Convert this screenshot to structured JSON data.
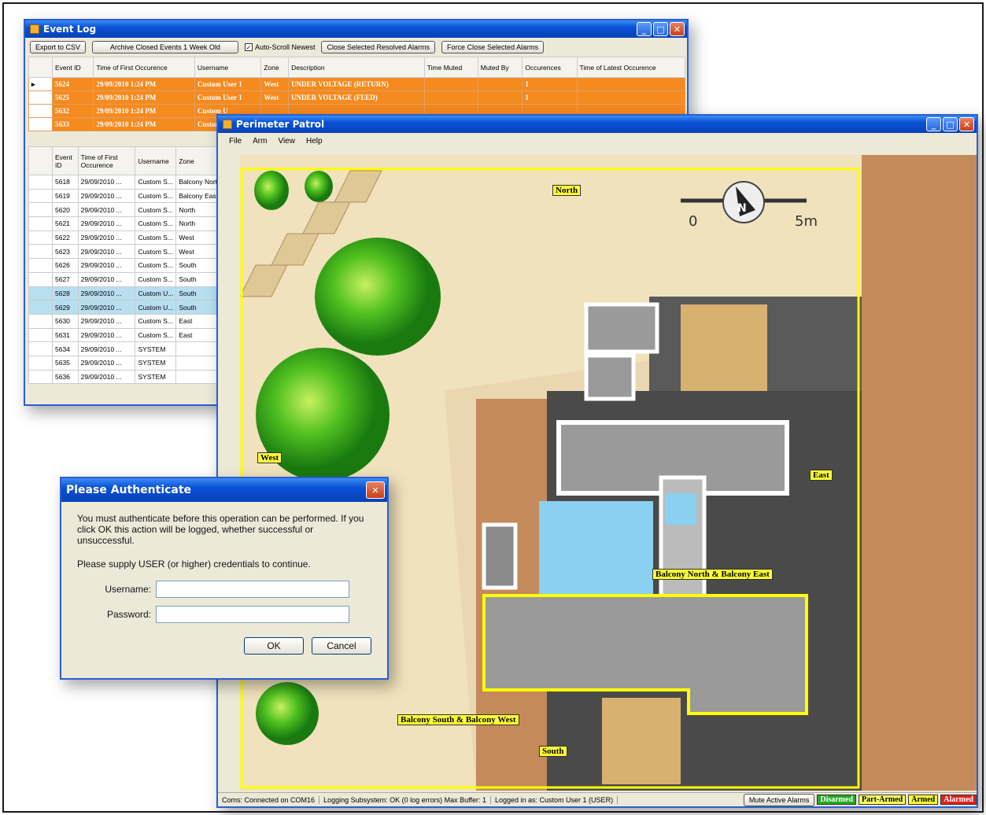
{
  "event_log": {
    "title": "Event Log",
    "toolbar": {
      "export": "Export to CSV",
      "archive": "Archive Closed Events 1 Week Old",
      "autoscroll": "Auto-Scroll Newest",
      "close_resolved": "Close Selected Resolved Alarms",
      "force_close": "Force Close Selected Alarms"
    },
    "active_columns": [
      "Event ID",
      "Time of First Occurence",
      "Username",
      "Zone",
      "Description",
      "Time Muted",
      "Muted By",
      "Occurences",
      "Time of Latest Occurence"
    ],
    "active_rows": [
      [
        "5624",
        "29/09/2010 1:24 PM",
        "Custom User 1",
        "West",
        "UNDER VOLTAGE (RETURN)",
        "",
        "",
        "1",
        ""
      ],
      [
        "5625",
        "29/09/2010 1:24 PM",
        "Custom User 1",
        "West",
        "UNDER VOLTAGE (FEED)",
        "",
        "",
        "1",
        ""
      ],
      [
        "5632",
        "29/09/2010 1:24 PM",
        "Custom U",
        "",
        "",
        "",
        "",
        "",
        ""
      ],
      [
        "5633",
        "29/09/2010 1:24 PM",
        "Custom",
        "",
        "",
        "",
        "",
        "",
        ""
      ]
    ],
    "history_columns": [
      "Event ID",
      "Time of First Occurence",
      "Username",
      "Zone"
    ],
    "history_rows": [
      [
        "5618",
        "29/09/2010 ...",
        "Custom S...",
        "Balcony Nort"
      ],
      [
        "5619",
        "29/09/2010 ...",
        "Custom S...",
        "Balcony East"
      ],
      [
        "5620",
        "29/09/2010 ...",
        "Custom S...",
        "North"
      ],
      [
        "5621",
        "29/09/2010 ...",
        "Custom S...",
        "North"
      ],
      [
        "5622",
        "29/09/2010 ...",
        "Custom S...",
        "West"
      ],
      [
        "5623",
        "29/09/2010 ...",
        "Custom S...",
        "West"
      ],
      [
        "5626",
        "29/09/2010 ...",
        "Custom S...",
        "South"
      ],
      [
        "5627",
        "29/09/2010 ...",
        "Custom S...",
        "South"
      ],
      [
        "5628",
        "29/09/2010 ...",
        "Custom U...",
        "South"
      ],
      [
        "5629",
        "29/09/2010 ...",
        "Custom U...",
        "South"
      ],
      [
        "5630",
        "29/09/2010 ...",
        "Custom S...",
        "East"
      ],
      [
        "5631",
        "29/09/2010 ...",
        "Custom S...",
        "East"
      ],
      [
        "5634",
        "29/09/2010 ...",
        "SYSTEM",
        ""
      ],
      [
        "5635",
        "29/09/2010 ...",
        "SYSTEM",
        ""
      ],
      [
        "5636",
        "29/09/2010 ...",
        "SYSTEM",
        ""
      ]
    ],
    "selected_history_rows": [
      8,
      9
    ],
    "colors": {
      "alarm_row": "#f58a1f",
      "selected_row": "#b8dff0"
    }
  },
  "perimeter": {
    "title": "Perimeter Patrol",
    "menu": [
      "File",
      "Arm",
      "View",
      "Help"
    ],
    "zones": {
      "north": "North",
      "west": "West",
      "east": "East",
      "balcony_ne": "Balcony North & Balcony East",
      "balcony_sw": "Balcony South & Balcony West",
      "south": "South"
    },
    "scale": {
      "start": "0",
      "end": "5m"
    },
    "compass_label": "N",
    "status": {
      "coms": "Coms: Connected on COM16",
      "logging": "Logging Subsystem: OK (0 log errors) Max Buffer: 1",
      "login": "Logged in as: Custom User 1 (USER)",
      "mute": "Mute Active Alarms",
      "disarmed": "Disarmed",
      "part_armed": "Part-Armed",
      "armed": "Armed",
      "alarmed": "Alarmed"
    },
    "status_colors": {
      "disarmed": "#22aa22",
      "part_armed": "#ffff66",
      "armed": "#ffff33",
      "alarmed": "#e02020"
    }
  },
  "auth": {
    "title": "Please Authenticate",
    "message": "You must authenticate before this operation can be performed. If you click OK this action will be logged, whether successful or unsuccessful.",
    "instruction": "Please supply USER (or higher) credentials to continue.",
    "username_label": "Username:",
    "password_label": "Password:",
    "username_value": "",
    "password_value": "",
    "ok": "OK",
    "cancel": "Cancel"
  }
}
